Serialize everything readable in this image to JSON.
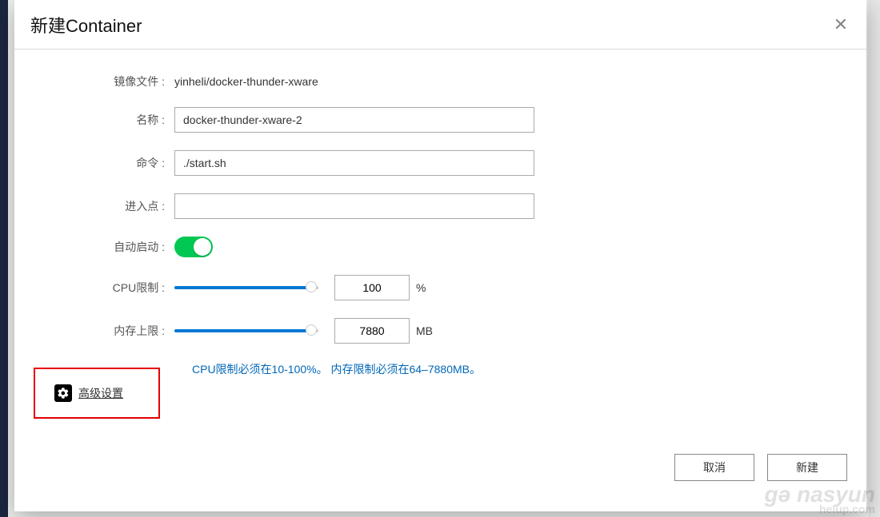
{
  "dialog": {
    "title": "新建Container",
    "close_symbol": "✕"
  },
  "form": {
    "image_label": "镜像文件 :",
    "image_value": "yinheli/docker-thunder-xware",
    "name_label": "名称 :",
    "name_value": "docker-thunder-xware-2",
    "command_label": "命令 :",
    "command_value": "./start.sh",
    "entrypoint_label": "进入点 :",
    "entrypoint_value": "",
    "autostart_label": "自动启动 :",
    "autostart_on": true,
    "cpu_label": "CPU限制 :",
    "cpu_value": "100",
    "cpu_unit": "%",
    "mem_label": "内存上限 :",
    "mem_value": "7880",
    "mem_unit": "MB",
    "hint": "CPU限制必须在10-100%。 内存限制必须在64–7880MB。"
  },
  "advanced": {
    "label": "高级设置"
  },
  "footer": {
    "cancel": "取消",
    "confirm": "新建"
  },
  "watermark": {
    "main": "gə nasyun",
    "sub": "helup.com"
  }
}
